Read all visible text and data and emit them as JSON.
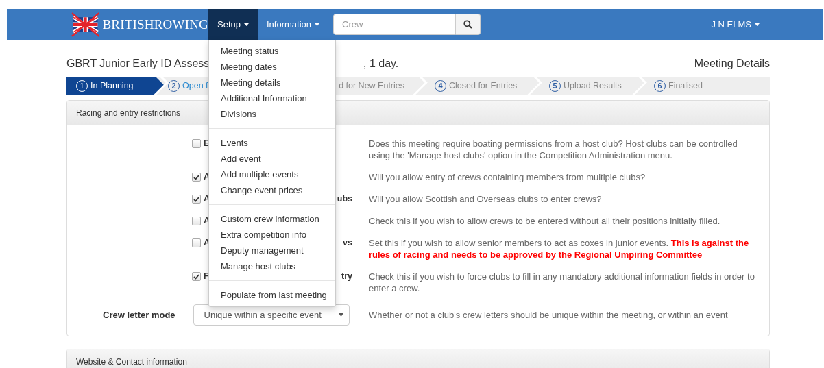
{
  "navbar": {
    "brand": "BRITISHROWING",
    "menus": [
      {
        "label": "Setup",
        "expanded": true
      },
      {
        "label": "Information",
        "expanded": false
      }
    ],
    "search": {
      "placeholder": "Crew"
    },
    "user": "J N ELMS"
  },
  "setup_menu": [
    [
      "Meeting status",
      "Meeting dates",
      "Meeting details",
      "Additional Information",
      "Divisions"
    ],
    [
      "Events",
      "Add event",
      "Add multiple events",
      "Change event prices"
    ],
    [
      "Custom crew information",
      "Extra competition info",
      "Deputy management",
      "Manage host clubs"
    ],
    [
      "Populate from last meeting"
    ]
  ],
  "title_start": "GBRT Junior Early ID Assess",
  "title_end": ", 1 day.",
  "page_heading": "Meeting Details",
  "steps": [
    {
      "number": "1",
      "label": "In Planning",
      "selected": true,
      "kind": "current"
    },
    {
      "number": "2",
      "label": "Open f",
      "selected": false,
      "kind": "next"
    },
    {
      "label": "d for New Entries",
      "selected": false,
      "kind": "future"
    },
    {
      "number": "4",
      "label": "Closed for Entries",
      "selected": false,
      "kind": "future"
    },
    {
      "number": "5",
      "label": "Upload Results",
      "selected": false,
      "kind": "future"
    },
    {
      "number": "6",
      "label": "Finalised",
      "selected": false,
      "kind": "future"
    }
  ],
  "panel": {
    "heading": "Racing and entry restrictions",
    "rows": [
      {
        "label_start": "E",
        "checked": false,
        "description": "Does this meeting require boating permissions from a host club? Host clubs can be controlled using the 'Manage host clubs' option in the Competition Administration menu."
      },
      {
        "label_start": "A",
        "checked": true,
        "description": "Will you allow entry of crews containing members from multiple clubs?"
      },
      {
        "label_start": "A",
        "label_end": "ubs",
        "checked": true,
        "description": "Will you allow Scottish and Overseas clubs to enter crews?"
      },
      {
        "label_start": "A",
        "checked": false,
        "description": "Check this if you wish to allow crews to be entered without all their positions initially filled."
      },
      {
        "label_start": "A",
        "label_end": "vs",
        "checked": false,
        "description": "Set this if you wish to allow senior members to act as coxes in junior events.  **This is against the rules of racing and needs to be approved by the Regional Umpiring Committee**"
      },
      {
        "label_start": "F",
        "label_end": "try",
        "checked": true,
        "description": "Check this if you wish to force clubs to fill in any mandatory additional information fields in order to enter a crew."
      }
    ],
    "select": {
      "label": "Crew letter mode",
      "value": "Unique within a specific event",
      "description": "Whether or not a club's crew letters should be unique within the meeting, or within an event"
    }
  },
  "panel2": {
    "heading": "Website & Contact information"
  }
}
